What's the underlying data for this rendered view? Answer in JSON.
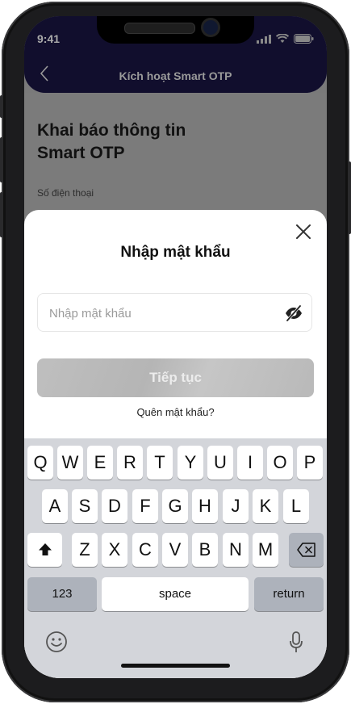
{
  "status_bar": {
    "time": "9:41"
  },
  "header": {
    "title": "Kích hoạt Smart OTP"
  },
  "background": {
    "title": "Khai báo thông tin\n Smart OTP",
    "phone_label": "Số điện thoại"
  },
  "sheet": {
    "title": "Nhập mật khẩu",
    "password_placeholder": "Nhập mật khẩu",
    "continue_label": "Tiếp tục",
    "forgot_label": "Quên mật khẩu?"
  },
  "keyboard": {
    "row1": [
      "Q",
      "W",
      "E",
      "R",
      "T",
      "Y",
      "U",
      "I",
      "O",
      "P"
    ],
    "row2": [
      "A",
      "S",
      "D",
      "F",
      "G",
      "H",
      "J",
      "K",
      "L"
    ],
    "row3": [
      "Z",
      "X",
      "C",
      "V",
      "B",
      "N",
      "M"
    ],
    "numbers_label": "123",
    "space_label": "space",
    "return_label": "return"
  },
  "colors": {
    "header_bg": "#1f1a52",
    "button_disabled": "#b9b9b9"
  }
}
